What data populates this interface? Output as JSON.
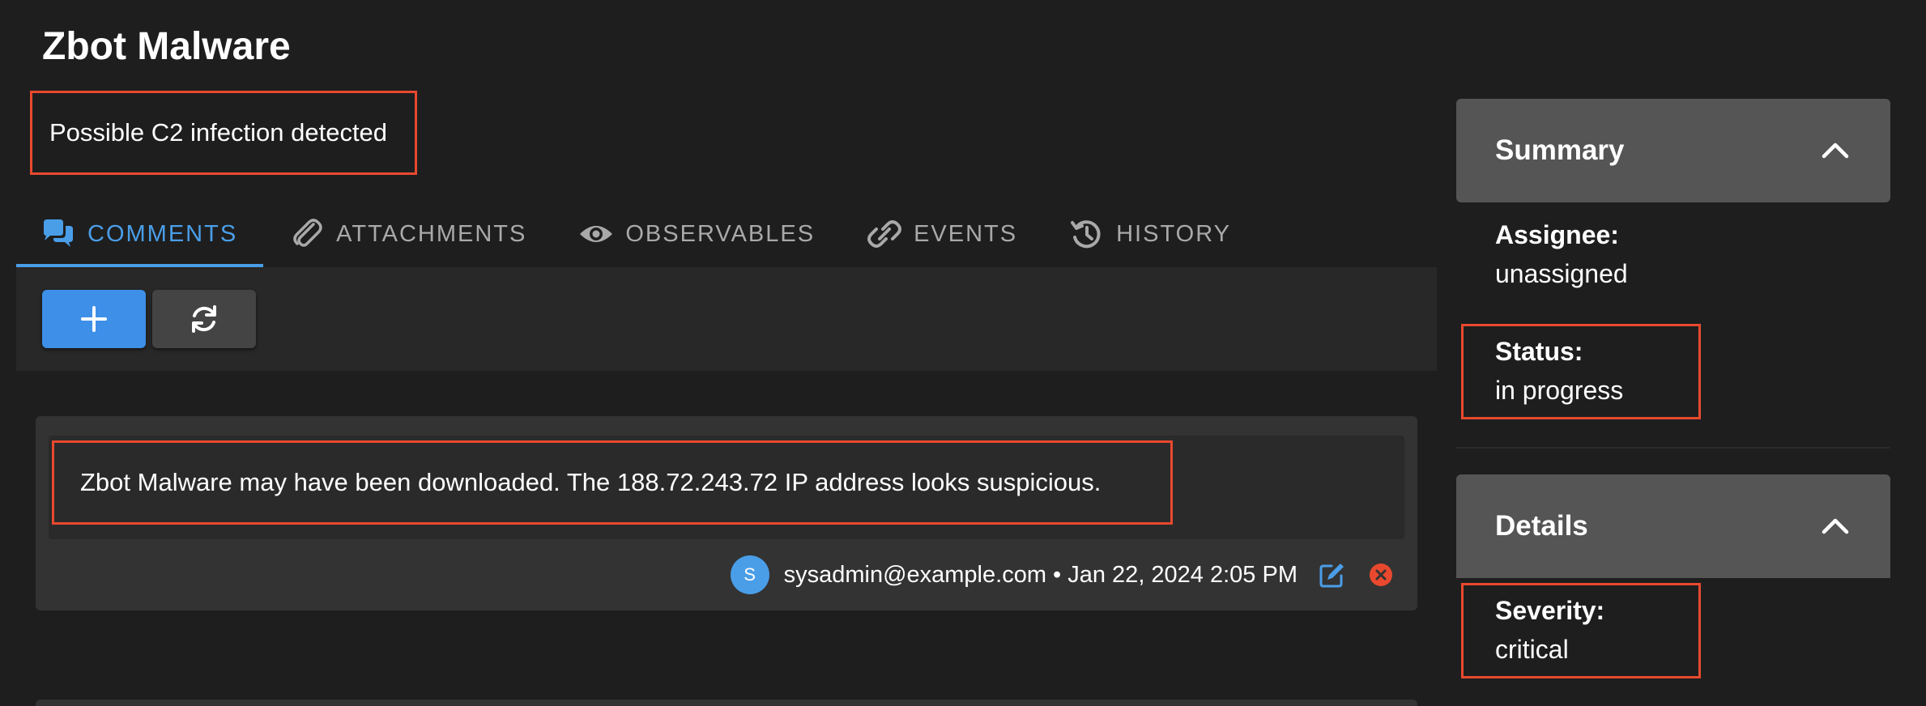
{
  "case": {
    "title": "Zbot Malware",
    "description": "Possible C2 infection detected"
  },
  "tabs": [
    {
      "label": "COMMENTS",
      "icon": "comments-icon",
      "active": true
    },
    {
      "label": "ATTACHMENTS",
      "icon": "paperclip-icon",
      "active": false
    },
    {
      "label": "OBSERVABLES",
      "icon": "eye-icon",
      "active": false
    },
    {
      "label": "EVENTS",
      "icon": "link-icon",
      "active": false
    },
    {
      "label": "HISTORY",
      "icon": "history-icon",
      "active": false
    }
  ],
  "toolbar": {
    "add_icon": "plus-icon",
    "refresh_icon": "refresh-icon"
  },
  "comment": {
    "text": "Zbot Malware may have been downloaded. The 188.72.243.72 IP address looks suspicious.",
    "avatar_initial": "S",
    "author_line": "sysadmin@example.com • Jan 22, 2024 2:05 PM"
  },
  "summary": {
    "header": "Summary",
    "assignee_label": "Assignee:",
    "assignee_value": "unassigned",
    "status_label": "Status:",
    "status_value": "in progress"
  },
  "details": {
    "header": "Details",
    "severity_label": "Severity:",
    "severity_value": "critical"
  },
  "colors": {
    "accent": "#4a9ee8",
    "highlight": "#e8492e",
    "delete": "#e8492e"
  }
}
